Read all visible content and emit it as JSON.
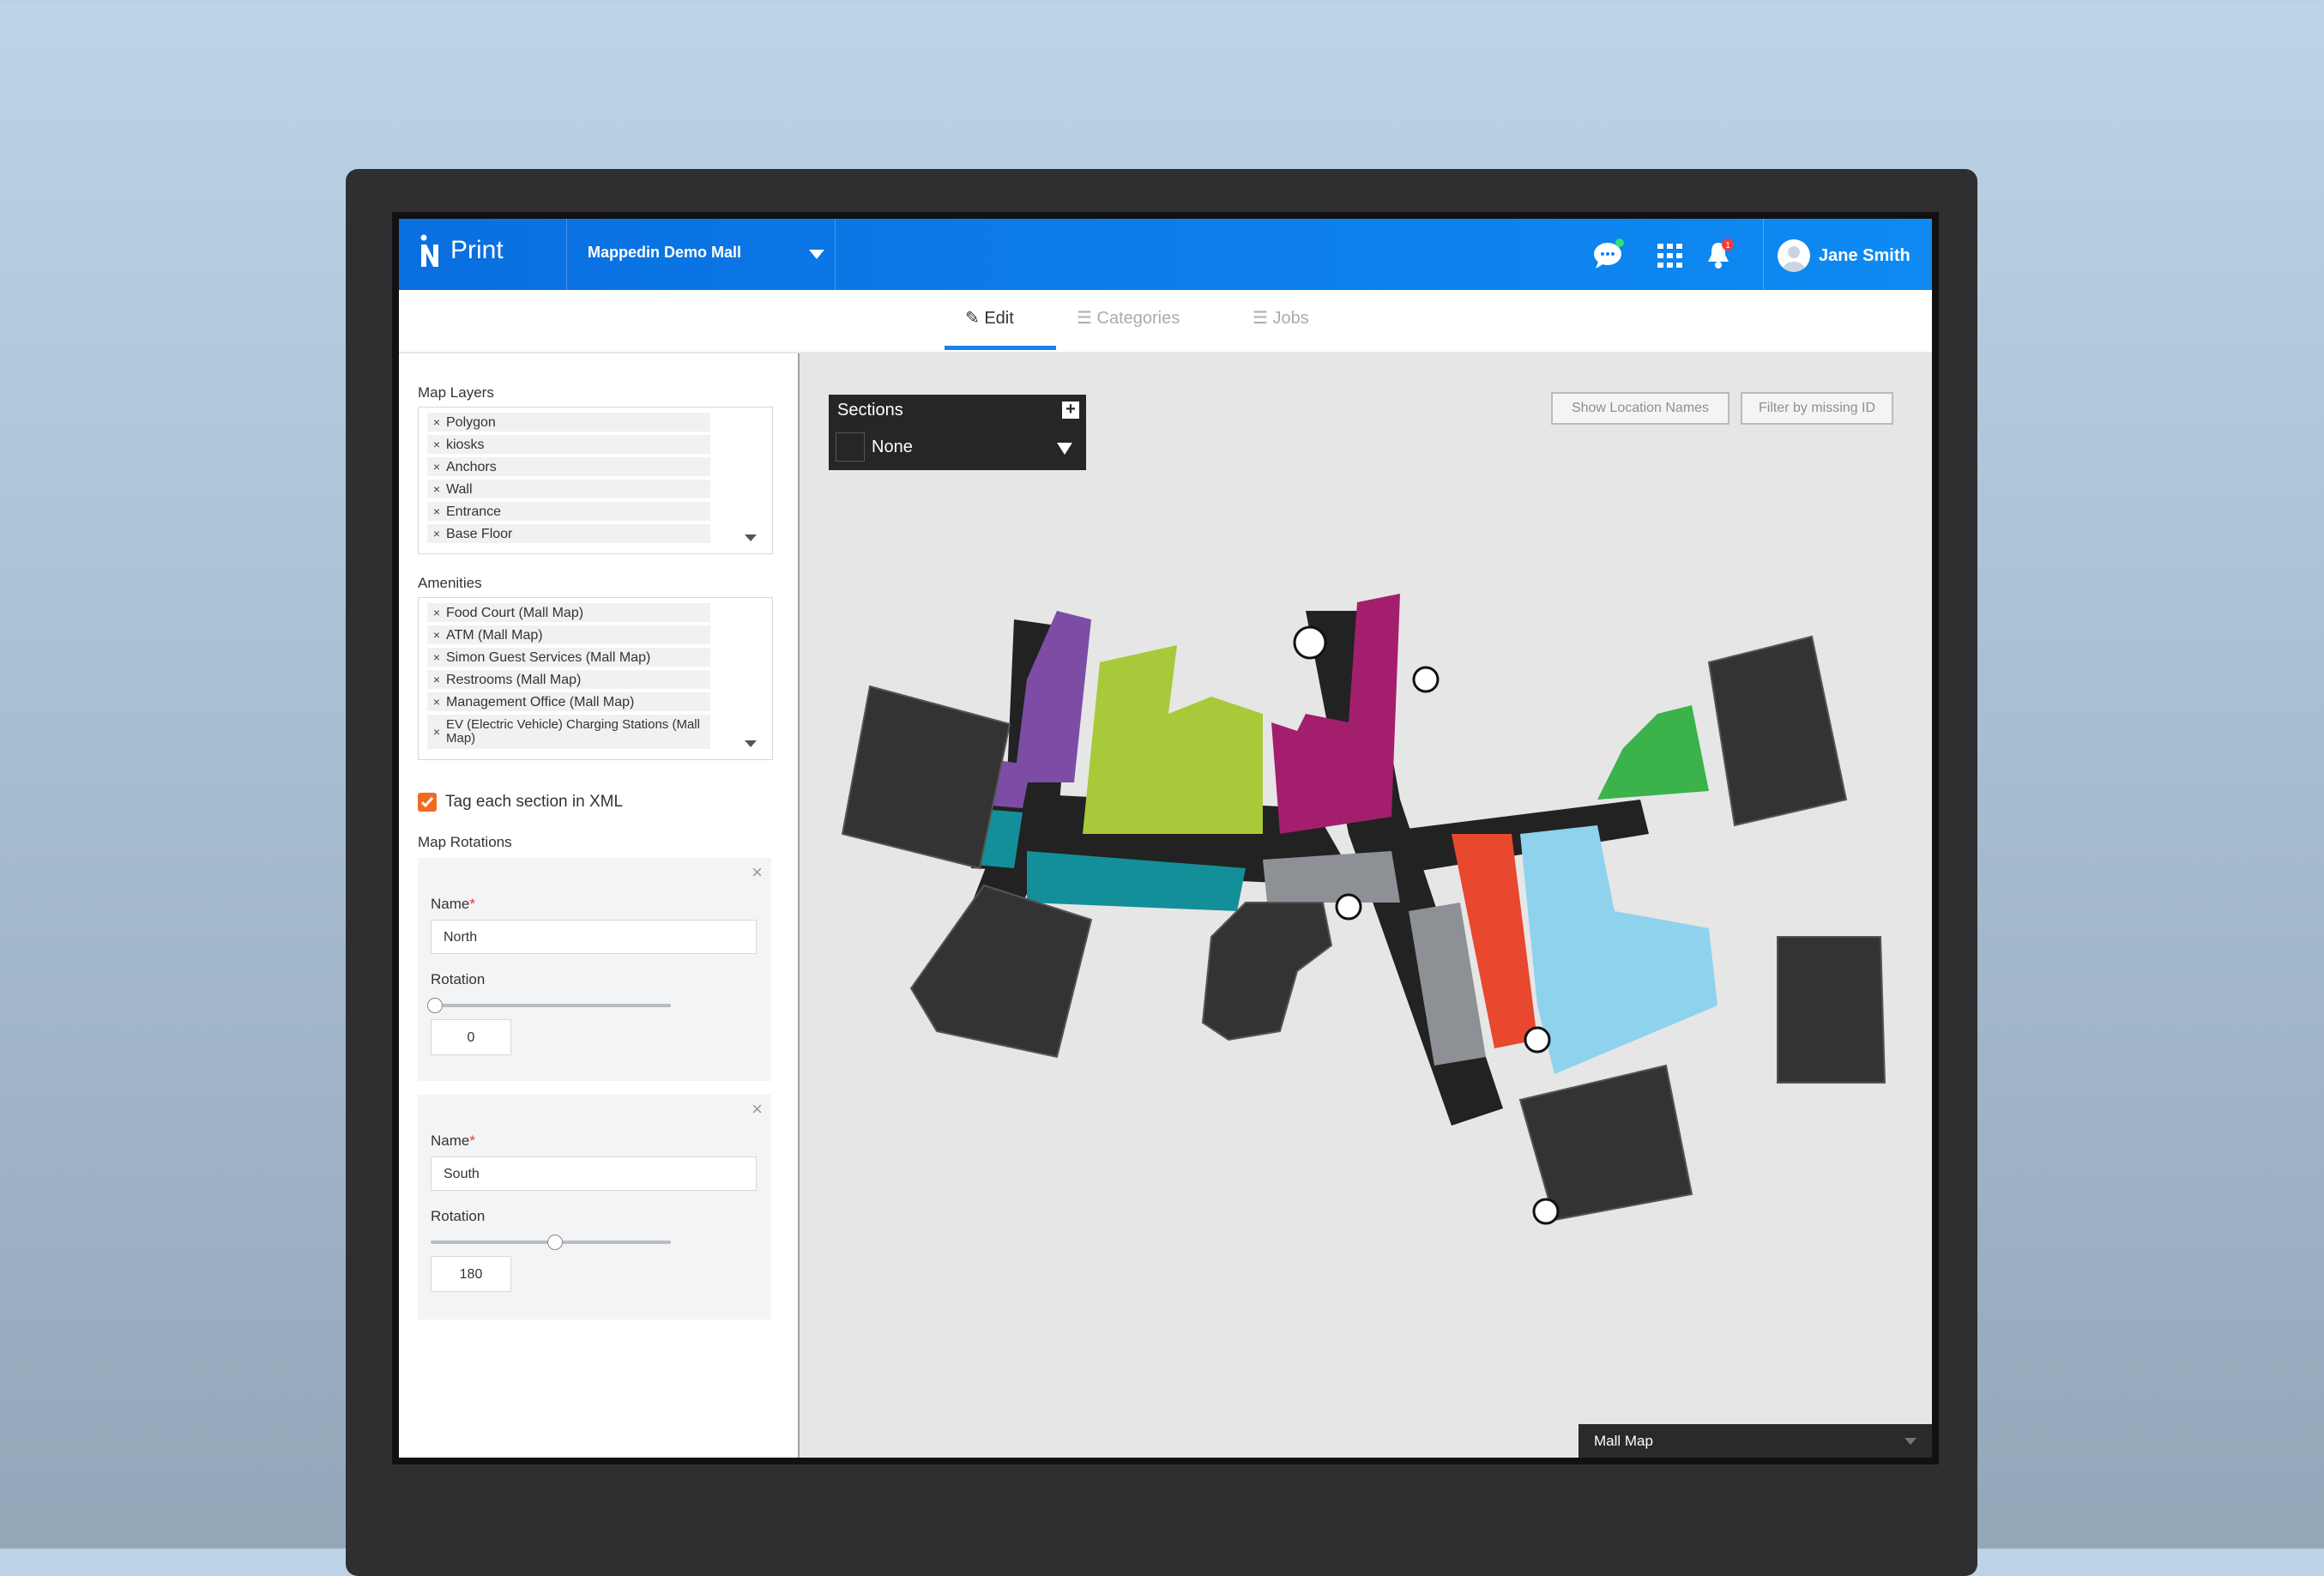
{
  "app": {
    "name": "Print",
    "venue": "Mappedin Demo Mall",
    "user": "Jane Smith",
    "notification_count": "1"
  },
  "colors": {
    "brand_blue": "#0e86f0",
    "accent_orange": "#f16a1f",
    "map_anchor": "#333333",
    "zone_purple": "#7d4da6",
    "zone_lime": "#a8c93a",
    "zone_teal": "#138f99",
    "zone_magenta": "#a31f6d",
    "zone_green": "#3bb24a",
    "zone_red": "#e8482e",
    "zone_lightblue": "#8fd2ee",
    "zone_gray": "#8d9196"
  },
  "tabs": [
    {
      "label": "Edit",
      "icon": "pencil-icon"
    },
    {
      "label": "Categories",
      "icon": "list-icon"
    },
    {
      "label": "Jobs",
      "icon": "list-icon"
    }
  ],
  "sidebar": {
    "map_layers_label": "Map Layers",
    "map_layers": [
      "Polygon",
      "kiosks",
      "Anchors",
      "Wall",
      "Entrance",
      "Base Floor"
    ],
    "amenities_label": "Amenities",
    "amenities": [
      "Food Court (Mall Map)",
      "ATM (Mall Map)",
      "Simon Guest Services (Mall Map)",
      "Restrooms (Mall Map)",
      "Management Office (Mall Map)",
      "EV (Electric Vehicle) Charging Stations (Mall Map)"
    ],
    "tag_sections_label": "Tag each section in XML",
    "tag_sections_checked": true,
    "map_rotations_label": "Map Rotations",
    "name_label": "Name",
    "required_mark": "*",
    "rotation_label": "Rotation",
    "rotations": [
      {
        "name": "North",
        "rotation": "0",
        "slider_fraction": 0.0
      },
      {
        "name": "South",
        "rotation": "180",
        "slider_fraction": 0.5
      }
    ]
  },
  "map": {
    "sections_title": "Sections",
    "section_value": "None",
    "show_location_names": "Show Location Names",
    "filter_missing_id": "Filter by missing ID",
    "layer_select": "Mall Map"
  }
}
